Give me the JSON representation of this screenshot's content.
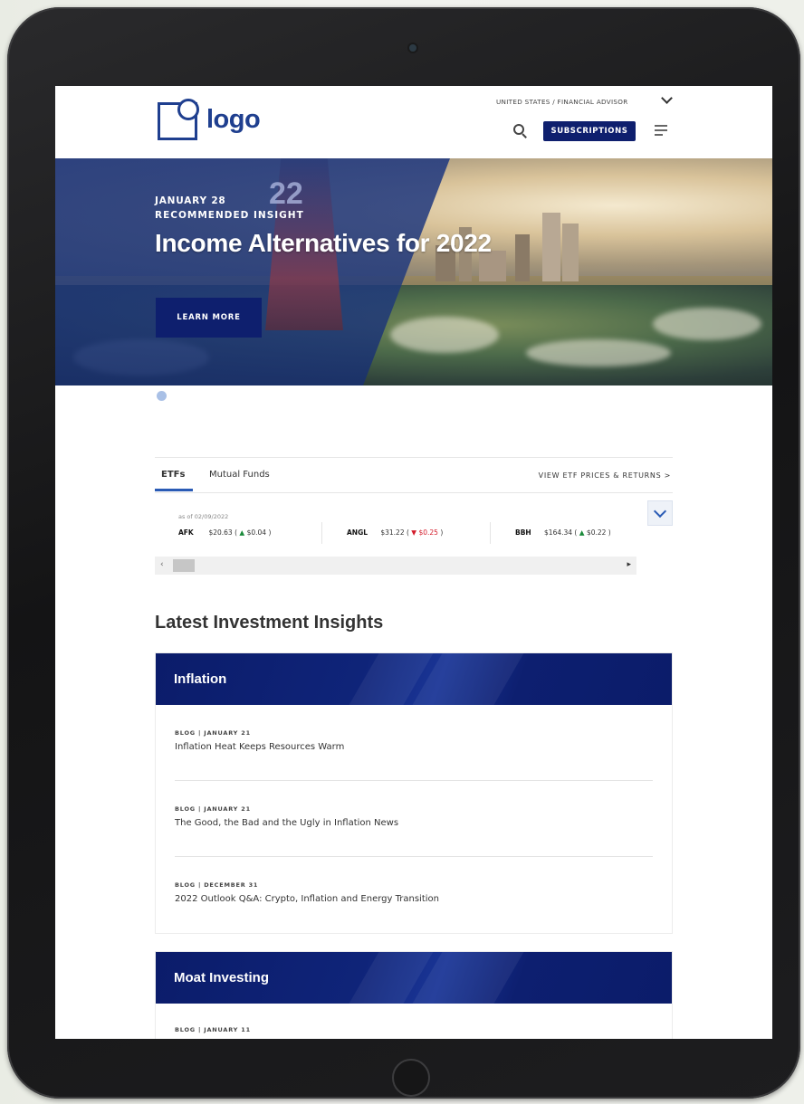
{
  "header": {
    "logo_text": "logo",
    "locale": "UNITED STATES / FINANCIAL ADVISOR",
    "subscriptions_label": "SUBSCRIPTIONS"
  },
  "hero": {
    "date": "JANUARY 28",
    "eyebrow": "RECOMMENDED INSIGHT",
    "title": "Income Alternatives for 2022",
    "button_label": "LEARN MORE",
    "buoy_number": "22"
  },
  "prices": {
    "tabs": [
      {
        "label": "ETFs",
        "active": true
      },
      {
        "label": "Mutual Funds",
        "active": false
      }
    ],
    "view_link": "VIEW ETF PRICES & RETURNS >",
    "as_of": "as of 02/09/2022",
    "tickers": [
      {
        "symbol": "AFK",
        "price": "$20.63",
        "change": "$0.04",
        "direction": "up"
      },
      {
        "symbol": "ANGL",
        "price": "$31.22",
        "change": "$0.25",
        "direction": "down"
      },
      {
        "symbol": "BBH",
        "price": "$164.34",
        "change": "$0.22",
        "direction": "up"
      }
    ]
  },
  "insights": {
    "title": "Latest Investment Insights",
    "cards": [
      {
        "title": "Inflation",
        "articles": [
          {
            "meta": "BLOG | JANUARY 21",
            "headline": "Inflation Heat Keeps Resources Warm"
          },
          {
            "meta": "BLOG | JANUARY 21",
            "headline": "The Good, the Bad and the Ugly in Inflation News"
          },
          {
            "meta": "BLOG | DECEMBER 31",
            "headline": "2022 Outlook Q&A: Crypto, Inflation and Energy Transition"
          }
        ]
      },
      {
        "title": "Moat Investing",
        "articles": [
          {
            "meta": "BLOG | JANUARY 11",
            "headline": ""
          }
        ]
      }
    ]
  },
  "colors": {
    "brand_navy": "#0e1f6e",
    "logo_blue": "#1f3f8f",
    "up_green": "#1a8a3a",
    "down_red": "#d31b2a"
  },
  "icons": [
    "search-icon",
    "menu-icon",
    "chevron-down-icon",
    "arrow-up-icon",
    "arrow-down-icon"
  ]
}
